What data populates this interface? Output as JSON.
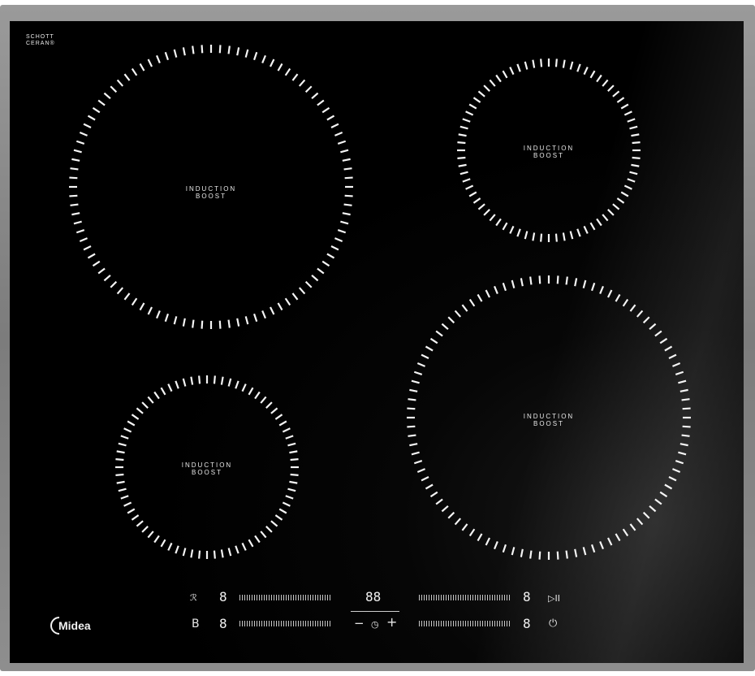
{
  "brand": {
    "glass_maker_line1": "SCHOTT",
    "glass_maker_line2": "CERAN®",
    "logo_text": "Midea"
  },
  "zones": [
    {
      "id": "rear-left",
      "label_line1": "INDUCTION",
      "label_line2": "BOOST"
    },
    {
      "id": "rear-right",
      "label_line1": "INDUCTION",
      "label_line2": "BOOST"
    },
    {
      "id": "front-left",
      "label_line1": "INDUCTION",
      "label_line2": "BOOST"
    },
    {
      "id": "front-right",
      "label_line1": "INDUCTION",
      "label_line2": "BOOST"
    }
  ],
  "controls": {
    "top_row": {
      "left_symbol": "ℛ",
      "left_display": "8",
      "timer_display": "88",
      "right_display": "8",
      "play_pause_symbol": "▷II"
    },
    "bottom_row": {
      "left_symbol": "B",
      "left_display": "8",
      "minus_symbol": "−",
      "timer_symbol": "◷",
      "plus_symbol": "+",
      "right_display": "8",
      "power_symbol": "⏻"
    }
  }
}
